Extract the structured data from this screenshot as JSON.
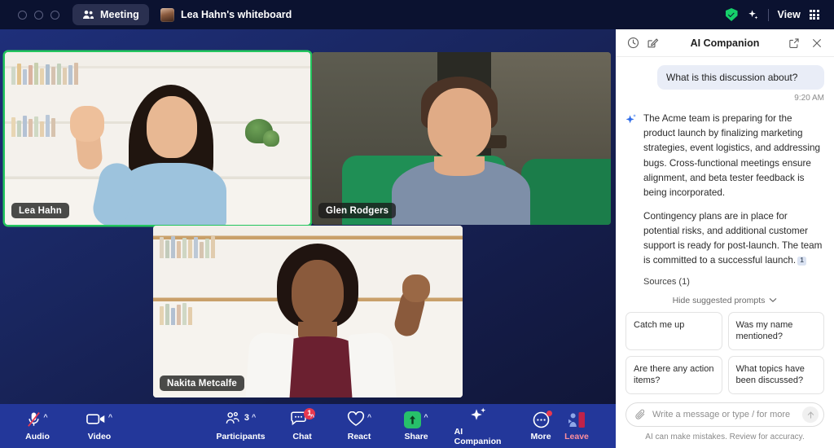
{
  "titlebar": {
    "meeting_tab": "Meeting",
    "whiteboard_tab": "Lea Hahn's whiteboard",
    "view_label": "View",
    "icons": {
      "meeting": "people-icon",
      "whiteboard_avatar": "avatar",
      "encryption": "green-shield-icon",
      "ai": "sparkle-icon",
      "layout": "grid-icon"
    }
  },
  "stage": {
    "tiles": [
      {
        "name": "Lea Hahn",
        "speaking": true
      },
      {
        "name": "Glen Rodgers",
        "speaking": false
      },
      {
        "name": "Nakita Metcalfe",
        "speaking": false
      }
    ]
  },
  "toolbar": {
    "items": [
      {
        "label": "Audio",
        "icon": "microphone-muted-icon",
        "chevron": true,
        "badge": null,
        "count": null,
        "dot": false
      },
      {
        "label": "Video",
        "icon": "camera-icon",
        "chevron": true,
        "badge": null,
        "count": null,
        "dot": false
      },
      {
        "label": "Participants",
        "icon": "participants-icon",
        "chevron": true,
        "badge": null,
        "count": "3",
        "dot": false
      },
      {
        "label": "Chat",
        "icon": "chat-icon",
        "chevron": true,
        "badge": "1",
        "count": null,
        "dot": false
      },
      {
        "label": "React",
        "icon": "heart-icon",
        "chevron": true,
        "badge": null,
        "count": null,
        "dot": false
      },
      {
        "label": "Share",
        "icon": "share-screen-icon",
        "chevron": true,
        "badge": null,
        "count": null,
        "dot": false
      },
      {
        "label": "AI Companion",
        "icon": "sparkle-icon",
        "chevron": false,
        "badge": null,
        "count": null,
        "dot": false
      },
      {
        "label": "More",
        "icon": "more-icon",
        "chevron": false,
        "badge": null,
        "count": null,
        "dot": true
      },
      {
        "label": "Leave",
        "icon": "leave-icon",
        "chevron": false,
        "badge": null,
        "count": null,
        "dot": false
      }
    ],
    "accents": {
      "share_green": "#27c06a",
      "badge_red": "#e8384f",
      "leave_red": "#ff8f9e",
      "bar_blue": "#23379a"
    }
  },
  "panel": {
    "title": "AI Companion",
    "header_icons": {
      "history": "history-icon",
      "compose": "compose-icon",
      "popout": "pop-out-icon",
      "close": "close-icon"
    },
    "user_message": "What is this discussion about?",
    "timestamp": "9:20 AM",
    "ai_paragraph_1": "The Acme team is preparing for the product launch by finalizing marketing strategies, event logistics, and addressing bugs. Cross-functional meetings ensure alignment, and beta tester feedback is being incorporated.",
    "ai_paragraph_2": "Contingency plans are in place for potential risks, and additional customer support is ready for post-launch. The team is committed to a successful launch.",
    "citation": "1",
    "sources_label": "Sources (1)",
    "actions": {
      "thumbs_up": "thumbs-up-icon",
      "thumbs_down": "thumbs-down-icon",
      "copy": "copy-icon"
    },
    "hide_prompts_label": "Hide suggested prompts",
    "suggested_prompts": [
      "Catch me up",
      "Was my name mentioned?",
      "Are there any action items?",
      "What topics have been discussed?"
    ],
    "composer_placeholder": "Write a message or type / for more",
    "attach_icon": "paperclip-icon",
    "send_icon": "send-arrow-icon",
    "disclaimer": "AI can make mistakes. Review for accuracy."
  }
}
